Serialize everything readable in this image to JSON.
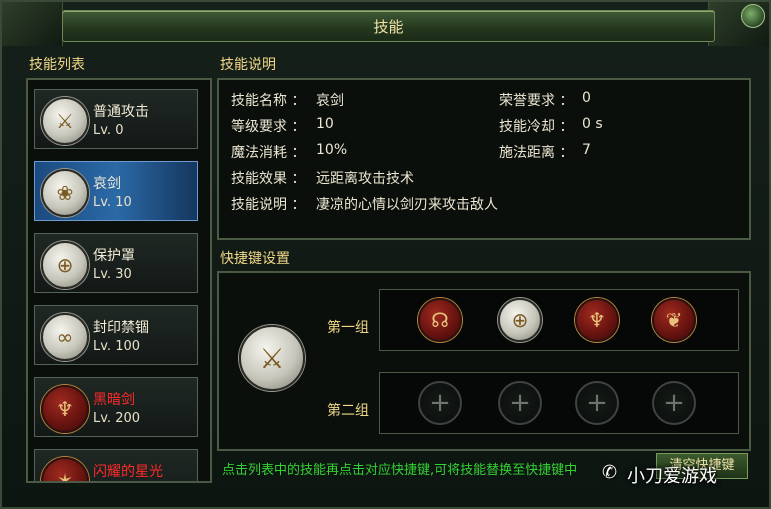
{
  "window": {
    "title": "技能"
  },
  "skill_list": {
    "header": "技能列表",
    "items": [
      {
        "name": "普通攻击",
        "level": "Lv. 0",
        "icon": "sword-icon",
        "style": "white",
        "name_color": "normal",
        "selected": false
      },
      {
        "name": "哀剑",
        "level": "Lv. 10",
        "icon": "lotus-icon",
        "style": "white",
        "name_color": "normal",
        "selected": true
      },
      {
        "name": "保护罩",
        "level": "Lv. 30",
        "icon": "shield-globe-icon",
        "style": "white",
        "name_color": "normal",
        "selected": false
      },
      {
        "name": "封印禁锢",
        "level": "Lv. 100",
        "icon": "chain-icon",
        "style": "white",
        "name_color": "normal",
        "selected": false
      },
      {
        "name": "黑暗剑",
        "level": "Lv. 200",
        "icon": "dragon-icon",
        "style": "red",
        "name_color": "#ff2a2a",
        "selected": false
      },
      {
        "name": "闪耀的星光",
        "level": "",
        "icon": "star-icon",
        "style": "red",
        "name_color": "#ff2a2a",
        "selected": false
      }
    ]
  },
  "description": {
    "header": "技能说明",
    "name_label": "技能名称 ：",
    "name_value": "哀剑",
    "honor_label": "荣誉要求 ：",
    "honor_value": "0",
    "level_label": "等级要求 ：",
    "level_value": "10",
    "cooldown_label": "技能冷却 ：",
    "cooldown_value": "0 s",
    "mana_label": "魔法消耗 ：",
    "mana_value": "10%",
    "range_label": "施法距离 ：",
    "range_value": "7",
    "effect_label": "技能效果 ：",
    "effect_value": "远距离攻击技术",
    "desc_label": "技能说明 ：",
    "desc_value": "凄凉的心情以剑刃来攻击敌人"
  },
  "hotkeys": {
    "header": "快捷键设置",
    "group1_label": "第一组",
    "group2_label": "第二组",
    "group1_slots": [
      "mask-icon",
      "shield-globe-icon",
      "dragon-icon",
      "twin-dragon-icon"
    ],
    "group2_slots": [
      "plus-icon",
      "plus-icon",
      "plus-icon",
      "plus-icon"
    ],
    "hint": "点击列表中的技能再点击对应快捷键,可将技能替换至快捷键中",
    "clear_button": "清空快捷键"
  },
  "watermark": "小刀爱游戏",
  "colors": {
    "accent_gold": "#f0d888",
    "hint_green": "#33d233",
    "select_blue": "#2b6aa6",
    "red_name": "#ff2a2a"
  }
}
